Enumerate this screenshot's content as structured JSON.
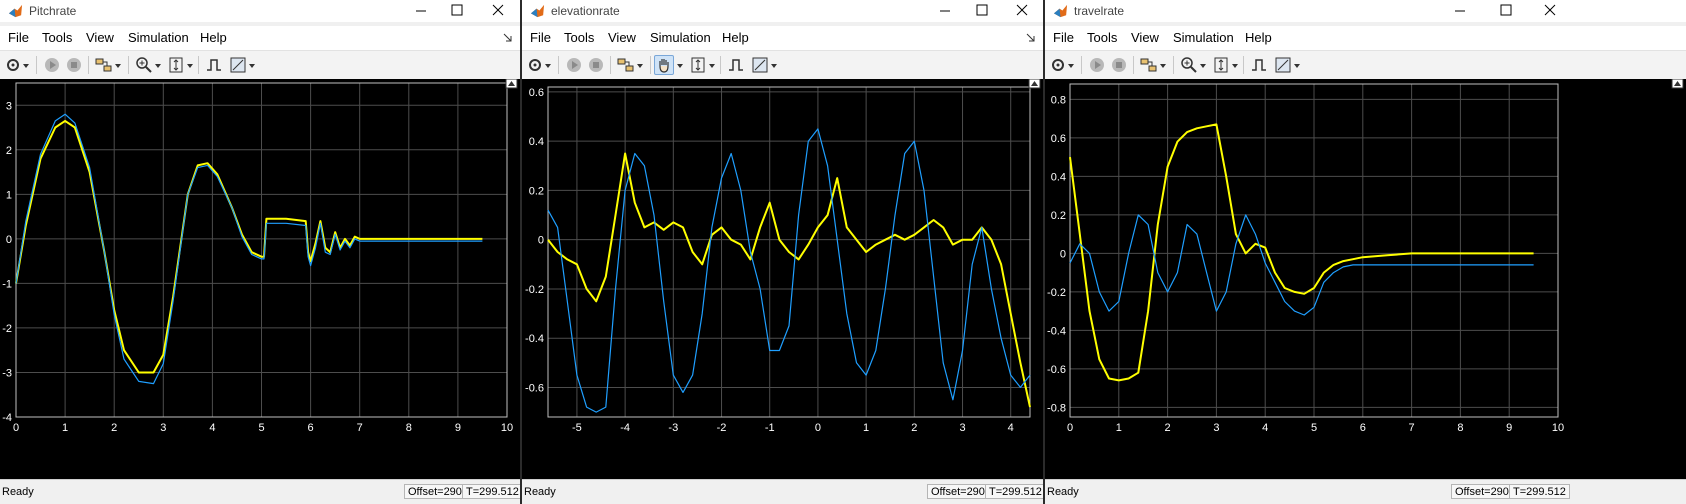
{
  "menu": [
    "File",
    "Tools",
    "View",
    "Simulation",
    "Help"
  ],
  "status": {
    "ready": "Ready",
    "offset": "Offset=290",
    "time": "T=299.512"
  },
  "colors": {
    "background": "#000000",
    "grid": "#4d4d4d",
    "series_yellow": "#ffff00",
    "series_blue": "#1f9fff",
    "axis_text": "#ffffff",
    "frame": "#c0c0c0"
  },
  "windows": [
    {
      "title": "Pitchrate",
      "chart_data": {
        "type": "line",
        "title": "",
        "xlabel": "",
        "ylabel": "",
        "xlim": [
          0,
          10
        ],
        "ylim": [
          -4,
          3.5
        ],
        "xticks": [
          0,
          1,
          2,
          3,
          4,
          5,
          6,
          7,
          8,
          9,
          10
        ],
        "yticks": [
          -4,
          -3,
          -2,
          -1,
          0,
          1,
          2,
          3
        ],
        "grid": true,
        "series": [
          {
            "color": "yellow",
            "x": [
              0,
              0.2,
              0.5,
              0.8,
              1,
              1.2,
              1.5,
              1.8,
              2,
              2.2,
              2.5,
              2.8,
              3,
              3.2,
              3.5,
              3.7,
              3.9,
              4.1,
              4.4,
              4.6,
              4.8,
              5,
              5.05,
              5.1,
              5.2,
              5.5,
              5.9,
              5.95,
              6,
              6.1,
              6.2,
              6.3,
              6.4,
              6.5,
              6.6,
              6.7,
              6.8,
              6.9,
              7,
              7.2,
              7.5,
              8,
              8.5,
              9,
              9.5
            ],
            "y": [
              -1,
              0.3,
              1.8,
              2.5,
              2.65,
              2.5,
              1.5,
              -0.3,
              -1.6,
              -2.5,
              -3,
              -3,
              -2.6,
              -1.3,
              1,
              1.65,
              1.7,
              1.45,
              0.7,
              0.1,
              -0.3,
              -0.4,
              -0.4,
              0.45,
              0.45,
              0.45,
              0.4,
              -0.3,
              -0.5,
              -0.1,
              0.4,
              -0.2,
              -0.3,
              0.15,
              -0.2,
              0,
              -0.15,
              0.05,
              0,
              0,
              0,
              0,
              0,
              0,
              0
            ]
          },
          {
            "color": "blue",
            "x": [
              0,
              0.2,
              0.5,
              0.8,
              1,
              1.2,
              1.5,
              1.8,
              2,
              2.2,
              2.5,
              2.8,
              3,
              3.2,
              3.5,
              3.7,
              3.9,
              4.1,
              4.4,
              4.6,
              4.8,
              5,
              5.05,
              5.1,
              5.2,
              5.5,
              5.9,
              5.95,
              6,
              6.1,
              6.2,
              6.3,
              6.4,
              6.5,
              6.6,
              6.7,
              6.8,
              6.9,
              7,
              7.2,
              7.5,
              8,
              8.5,
              9,
              9.5
            ],
            "y": [
              -1,
              0.4,
              1.9,
              2.65,
              2.8,
              2.6,
              1.6,
              -0.3,
              -1.7,
              -2.7,
              -3.2,
              -3.25,
              -2.8,
              -1.4,
              1,
              1.6,
              1.65,
              1.4,
              0.7,
              0.05,
              -0.35,
              -0.45,
              -0.45,
              0.35,
              0.35,
              0.35,
              0.3,
              -0.4,
              -0.6,
              -0.2,
              0.35,
              -0.3,
              -0.35,
              0.1,
              -0.25,
              -0.05,
              -0.2,
              0,
              -0.05,
              -0.05,
              -0.05,
              -0.05,
              -0.05,
              -0.05,
              -0.05
            ]
          }
        ]
      }
    },
    {
      "title": "elevationrate",
      "chart_data": {
        "type": "line",
        "title": "",
        "xlabel": "",
        "ylabel": "",
        "xlim": [
          -5.6,
          4.4
        ],
        "ylim": [
          -0.72,
          0.62
        ],
        "xticks": [
          -5,
          -4,
          -3,
          -2,
          -1,
          0,
          1,
          2,
          3,
          4
        ],
        "yticks": [
          -0.6,
          -0.4,
          -0.2,
          0,
          0.2,
          0.4,
          0.6
        ],
        "grid": true,
        "series": [
          {
            "color": "yellow",
            "x": [
              -5.6,
              -5.4,
              -5.2,
              -5,
              -4.8,
              -4.6,
              -4.4,
              -4.2,
              -4,
              -3.8,
              -3.6,
              -3.4,
              -3.2,
              -3,
              -2.8,
              -2.6,
              -2.4,
              -2.2,
              -2,
              -1.8,
              -1.6,
              -1.4,
              -1.2,
              -1,
              -0.8,
              -0.6,
              -0.4,
              -0.2,
              0,
              0.2,
              0.4,
              0.6,
              0.8,
              1,
              1.2,
              1.4,
              1.6,
              1.8,
              2,
              2.2,
              2.4,
              2.6,
              2.8,
              3,
              3.2,
              3.4,
              3.6,
              3.8,
              4,
              4.2,
              4.4
            ],
            "y": [
              0,
              -0.05,
              -0.08,
              -0.1,
              -0.2,
              -0.25,
              -0.15,
              0.1,
              0.35,
              0.15,
              0.05,
              0.07,
              0.04,
              0.07,
              0.05,
              -0.05,
              -0.1,
              0.02,
              0.05,
              0,
              -0.02,
              -0.08,
              0.05,
              0.15,
              0,
              -0.05,
              -0.08,
              -0.02,
              0.05,
              0.1,
              0.25,
              0.05,
              0,
              -0.05,
              -0.02,
              0,
              0.02,
              0,
              0.02,
              0.05,
              0.08,
              0.05,
              -0.02,
              0,
              0,
              0.05,
              0,
              -0.1,
              -0.3,
              -0.5,
              -0.68
            ]
          },
          {
            "color": "blue",
            "x": [
              -5.6,
              -5.4,
              -5.2,
              -5,
              -4.8,
              -4.6,
              -4.4,
              -4.2,
              -4,
              -3.8,
              -3.6,
              -3.4,
              -3.2,
              -3,
              -2.8,
              -2.6,
              -2.4,
              -2.2,
              -2,
              -1.8,
              -1.6,
              -1.4,
              -1.2,
              -1,
              -0.8,
              -0.6,
              -0.4,
              -0.2,
              0,
              0.2,
              0.4,
              0.6,
              0.8,
              1,
              1.2,
              1.4,
              1.6,
              1.8,
              2,
              2.2,
              2.4,
              2.6,
              2.8,
              3,
              3.2,
              3.4,
              3.6,
              3.8,
              4,
              4.2,
              4.4
            ],
            "y": [
              0.12,
              0.05,
              -0.25,
              -0.55,
              -0.68,
              -0.7,
              -0.68,
              -0.2,
              0.2,
              0.35,
              0.3,
              0.1,
              -0.25,
              -0.55,
              -0.62,
              -0.55,
              -0.3,
              0.05,
              0.25,
              0.35,
              0.2,
              -0.05,
              -0.2,
              -0.45,
              -0.45,
              -0.35,
              0.1,
              0.4,
              0.45,
              0.3,
              0,
              -0.3,
              -0.5,
              -0.55,
              -0.45,
              -0.2,
              0.1,
              0.35,
              0.4,
              0.2,
              -0.15,
              -0.5,
              -0.65,
              -0.45,
              -0.1,
              0.05,
              -0.2,
              -0.4,
              -0.55,
              -0.6,
              -0.55
            ]
          }
        ]
      }
    },
    {
      "title": "travelrate",
      "chart_data": {
        "type": "line",
        "title": "",
        "xlabel": "",
        "ylabel": "",
        "xlim": [
          0,
          10
        ],
        "ylim": [
          -0.85,
          0.88
        ],
        "xticks": [
          0,
          1,
          2,
          3,
          4,
          5,
          6,
          7,
          8,
          9,
          10
        ],
        "yticks": [
          -0.8,
          -0.6,
          -0.4,
          -0.2,
          0,
          0.2,
          0.4,
          0.6,
          0.8
        ],
        "grid": true,
        "series": [
          {
            "color": "yellow",
            "x": [
              0,
              0.2,
              0.4,
              0.6,
              0.8,
              1,
              1.2,
              1.4,
              1.6,
              1.8,
              2,
              2.2,
              2.4,
              2.6,
              2.8,
              3,
              3.2,
              3.4,
              3.6,
              3.8,
              4,
              4.2,
              4.4,
              4.6,
              4.8,
              5,
              5.2,
              5.4,
              5.6,
              5.8,
              6,
              6.5,
              7,
              7.5,
              8,
              8.5,
              9,
              9.5
            ],
            "y": [
              0.5,
              0.1,
              -0.3,
              -0.55,
              -0.65,
              -0.66,
              -0.65,
              -0.62,
              -0.3,
              0.15,
              0.45,
              0.58,
              0.63,
              0.65,
              0.66,
              0.67,
              0.4,
              0.1,
              0,
              0.05,
              0.03,
              -0.1,
              -0.18,
              -0.2,
              -0.21,
              -0.18,
              -0.1,
              -0.06,
              -0.04,
              -0.03,
              -0.02,
              -0.01,
              0,
              0,
              0,
              0,
              0,
              0
            ]
          },
          {
            "color": "blue",
            "x": [
              0,
              0.2,
              0.4,
              0.6,
              0.8,
              1,
              1.2,
              1.4,
              1.6,
              1.8,
              2,
              2.2,
              2.4,
              2.6,
              2.8,
              3,
              3.2,
              3.4,
              3.6,
              3.8,
              4,
              4.2,
              4.4,
              4.6,
              4.8,
              5,
              5.2,
              5.4,
              5.6,
              5.8,
              6,
              6.5,
              7,
              7.5,
              8,
              8.5,
              9,
              9.5
            ],
            "y": [
              -0.05,
              0.05,
              0,
              -0.2,
              -0.3,
              -0.25,
              0,
              0.2,
              0.15,
              -0.1,
              -0.2,
              -0.1,
              0.15,
              0.1,
              -0.1,
              -0.3,
              -0.2,
              0.05,
              0.2,
              0.1,
              -0.05,
              -0.15,
              -0.25,
              -0.3,
              -0.32,
              -0.28,
              -0.15,
              -0.1,
              -0.07,
              -0.06,
              -0.06,
              -0.06,
              -0.06,
              -0.06,
              -0.06,
              -0.06,
              -0.06,
              -0.06
            ]
          }
        ]
      }
    }
  ]
}
